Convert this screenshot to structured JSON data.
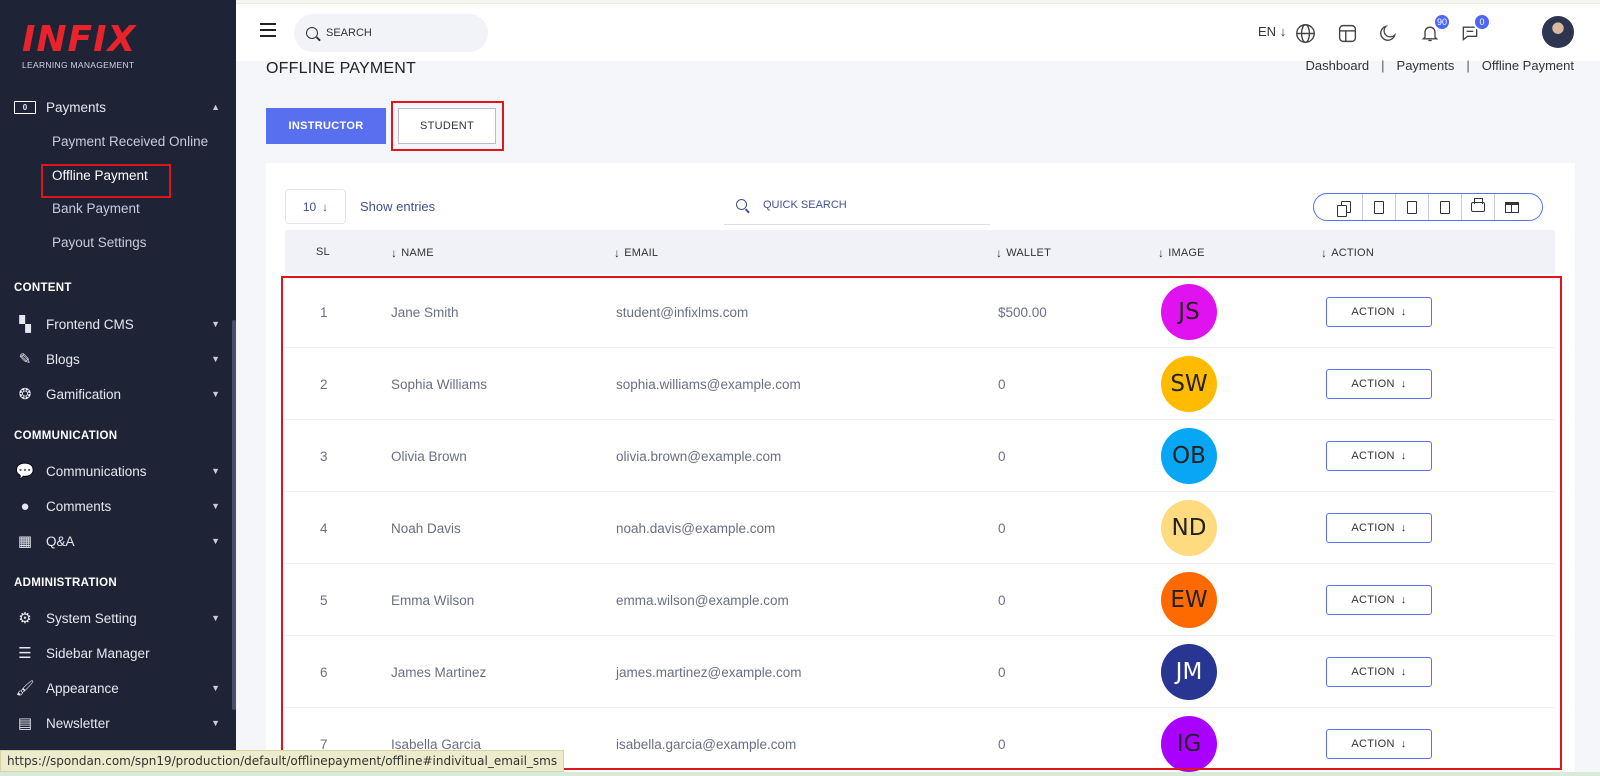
{
  "brand": {
    "logo": "INFIX",
    "tagline": "LEARNING MANAGEMENT"
  },
  "sidebar": {
    "payments": {
      "label": "Payments",
      "items": [
        "Payment Received Online",
        "Offline Payment",
        "Bank Payment",
        "Payout Settings"
      ]
    },
    "sections": [
      {
        "title": "CONTENT",
        "items": [
          {
            "label": "Frontend CMS",
            "icon": "paint-roller-icon"
          },
          {
            "label": "Blogs",
            "icon": "edit-icon"
          },
          {
            "label": "Gamification",
            "icon": "medal-icon"
          }
        ]
      },
      {
        "title": "COMMUNICATION",
        "items": [
          {
            "label": "Communications",
            "icon": "chat-icon"
          },
          {
            "label": "Comments",
            "icon": "comment-icon"
          },
          {
            "label": "Q&A",
            "icon": "grid-icon"
          }
        ]
      },
      {
        "title": "ADMINISTRATION",
        "items": [
          {
            "label": "System Setting",
            "icon": "gears-icon"
          },
          {
            "label": "Sidebar Manager",
            "icon": "bars-icon"
          },
          {
            "label": "Appearance",
            "icon": "brush-icon"
          },
          {
            "label": "Newsletter",
            "icon": "newsletter-icon"
          }
        ]
      }
    ]
  },
  "topbar": {
    "search_placeholder": "SEARCH",
    "language": "EN",
    "notifications_count": "90",
    "messages_count": "0"
  },
  "page": {
    "title": "OFFLINE PAYMENT",
    "breadcrumb": [
      "Dashboard",
      "Payments",
      "Offline Payment"
    ],
    "tabs": {
      "instructor": "INSTRUCTOR",
      "student": "STUDENT"
    }
  },
  "table": {
    "entries_value": "10",
    "entries_label": "Show entries",
    "quick_search_placeholder": "QUICK SEARCH",
    "columns": {
      "sl": "SL",
      "name": "NAME",
      "email": "EMAIL",
      "wallet": "WALLET",
      "image": "IMAGE",
      "action": "ACTION"
    },
    "action_label": "ACTION",
    "rows": [
      {
        "sl": "1",
        "name": "Jane Smith",
        "email": "student@infixlms.com",
        "wallet": "$500.00",
        "initials": "JS",
        "color": "#e012ef"
      },
      {
        "sl": "2",
        "name": "Sophia Williams",
        "email": "sophia.williams@example.com",
        "wallet": "0",
        "initials": "SW",
        "color": "#ffbb00"
      },
      {
        "sl": "3",
        "name": "Olivia Brown",
        "email": "olivia.brown@example.com",
        "wallet": "0",
        "initials": "OB",
        "color": "#08a7f5"
      },
      {
        "sl": "4",
        "name": "Noah Davis",
        "email": "noah.davis@example.com",
        "wallet": "0",
        "initials": "ND",
        "color": "#ffdb80"
      },
      {
        "sl": "5",
        "name": "Emma Wilson",
        "email": "emma.wilson@example.com",
        "wallet": "0",
        "initials": "EW",
        "color": "#ff6a00"
      },
      {
        "sl": "6",
        "name": "James Martinez",
        "email": "james.martinez@example.com",
        "wallet": "0",
        "initials": "JM",
        "color": "#283593"
      },
      {
        "sl": "7",
        "name": "Isabella Garcia",
        "email": "isabella.garcia@example.com",
        "wallet": "0",
        "initials": "IG",
        "color": "#aa00ff"
      }
    ]
  },
  "status_url": "https://spondan.com/spn19/production/default/offlinepayment/offline#indivitual_email_sms"
}
